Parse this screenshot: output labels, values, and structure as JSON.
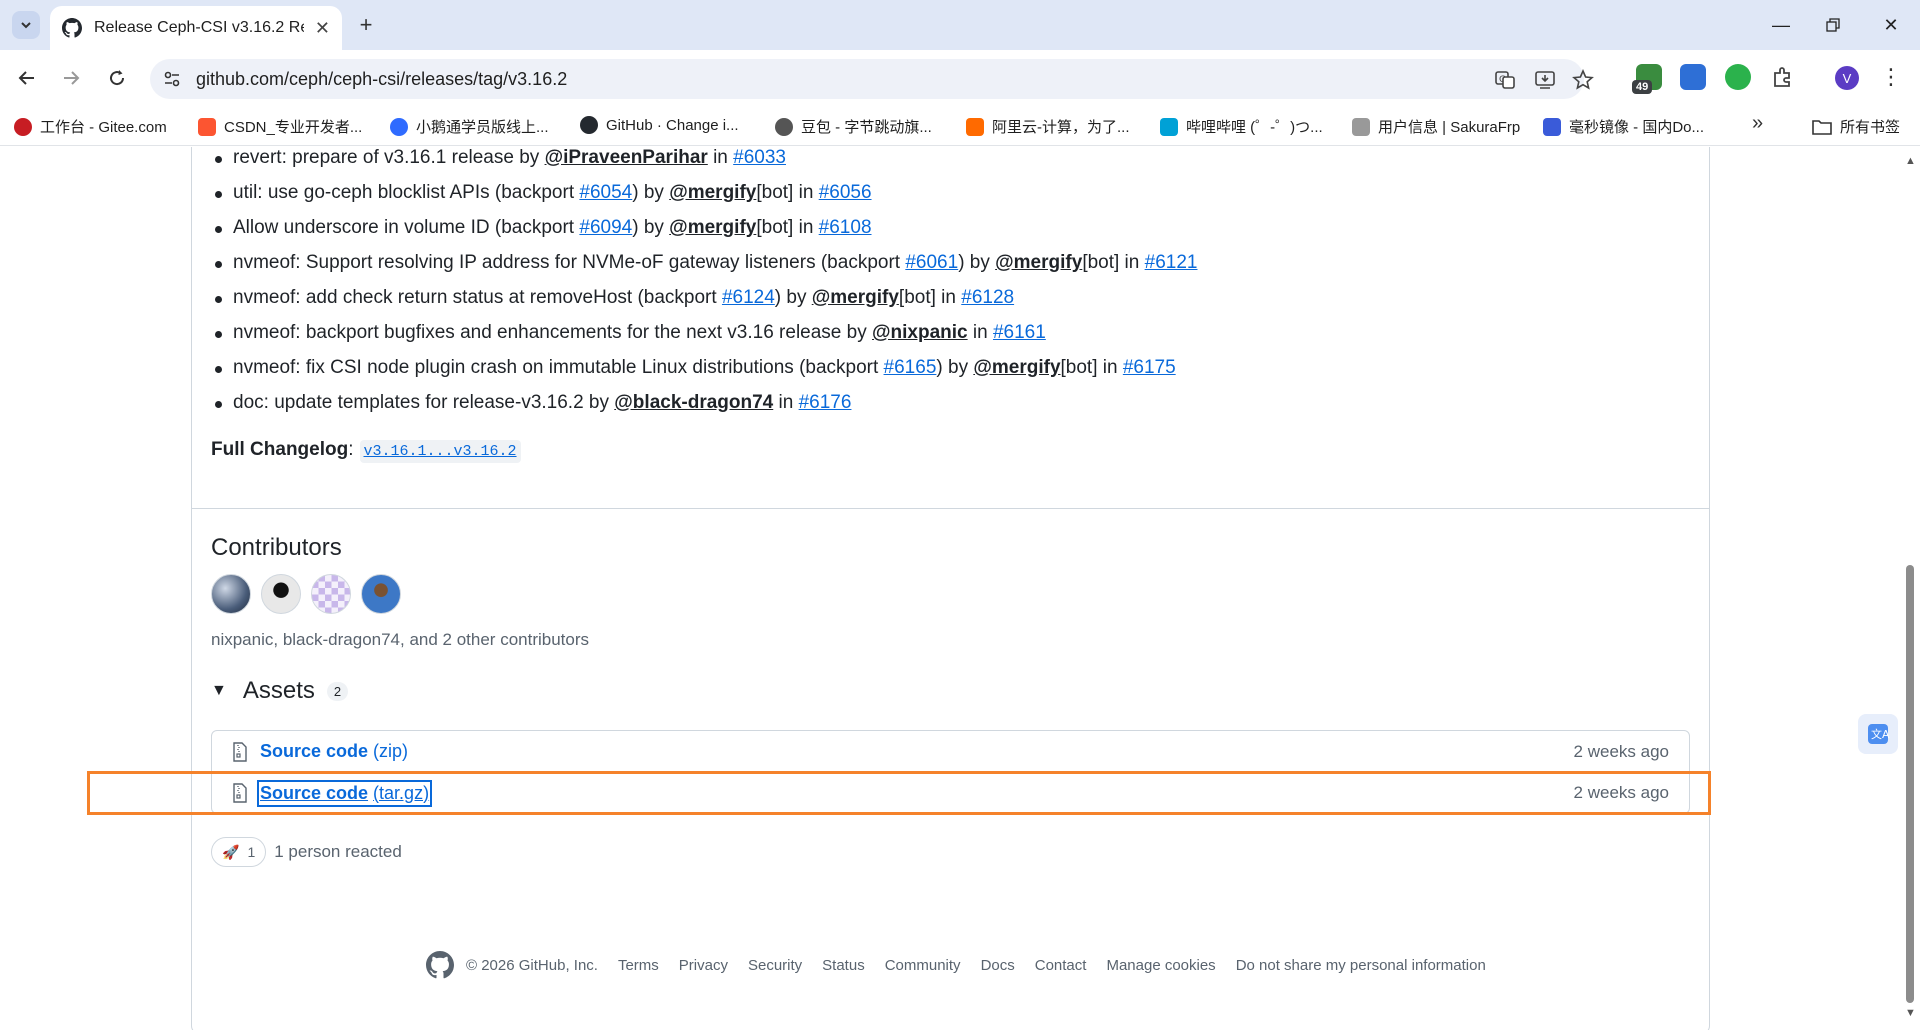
{
  "browser": {
    "tab_title": "Release Ceph-CSI v3.16.2 Rel",
    "url": "github.com/ceph/ceph-csi/releases/tag/v3.16.2",
    "extension_badge": "49",
    "profile_initial": "V"
  },
  "bookmarks": [
    {
      "label": "工作台 - Gitee.com",
      "color": "#c71d23"
    },
    {
      "label": "CSDN_专业开发者...",
      "color": "#fc5531"
    },
    {
      "label": "小鹅通学员版线上...",
      "color": "#2f6bff"
    },
    {
      "label": "GitHub · Change i...",
      "color": "#24292f"
    },
    {
      "label": "豆包 - 字节跳动旗...",
      "color": "#555555"
    },
    {
      "label": "阿里云-计算，为了...",
      "color": "#ff6a00"
    },
    {
      "label": "哔哩哔哩 (゜-゜)つ...",
      "color": "#00a1d6"
    },
    {
      "label": "用户信息 | SakuraFrp",
      "color": "#999999"
    },
    {
      "label": "毫秒镜像 - 国内Do...",
      "color": "#3a5bd9"
    }
  ],
  "bookmarks_folder": "所有书签",
  "changes": [
    {
      "pre": "revert: prepare of v3.16.1 release by ",
      "user": "@iPraveenParihar",
      "mid": " in ",
      "pr": "#6033"
    },
    {
      "pre": "util: use go-ceph blocklist APIs (backport ",
      "bp": "#6054",
      "bp_post": ") by ",
      "user": "@mergify",
      "post_user": "[bot] in ",
      "pr": "#6056"
    },
    {
      "pre": "Allow underscore in volume ID (backport ",
      "bp": "#6094",
      "bp_post": ") by ",
      "user": "@mergify",
      "post_user": "[bot] in ",
      "pr": "#6108"
    },
    {
      "pre": "nvmeof: Support resolving IP address for NVMe-oF gateway listeners (backport ",
      "bp": "#6061",
      "bp_post": ") by ",
      "user": "@mergify",
      "post_user": "[bot] in ",
      "pr": "#6121"
    },
    {
      "pre": "nvmeof: add check return status at removeHost (backport ",
      "bp": "#6124",
      "bp_post": ") by ",
      "user": "@mergify",
      "post_user": "[bot] in ",
      "pr": "#6128"
    },
    {
      "pre": "nvmeof: backport bugfixes and enhancements for the next v3.16 release by ",
      "user": "@nixpanic",
      "mid": " in ",
      "pr": "#6161"
    },
    {
      "pre": "nvmeof: fix CSI node plugin crash on immutable Linux distributions (backport ",
      "bp": "#6165",
      "bp_post": ") by ",
      "user": "@mergify",
      "post_user": "[bot] in ",
      "pr": "#6175"
    },
    {
      "pre": "doc: update templates for release-v3.16.2 by ",
      "user": "@black-dragon74",
      "mid": " in ",
      "pr": "#6176"
    }
  ],
  "changelog": {
    "label": "Full Changelog",
    "sep": ":",
    "range": "v3.16.1...v3.16.2"
  },
  "contributors": {
    "title": "Contributors",
    "summary": "nixpanic, black-dragon74, and 2 other contributors"
  },
  "assets": {
    "title": "Assets",
    "count": "2",
    "rows": [
      {
        "name": "Source code",
        "ext": "(zip)",
        "time": "2 weeks ago"
      },
      {
        "name": "Source code",
        "ext": "(tar.gz)",
        "time": "2 weeks ago"
      }
    ]
  },
  "reactions": {
    "count": "1",
    "text": "1 person reacted"
  },
  "footer": {
    "copyright": "© 2026 GitHub, Inc.",
    "links": [
      "Terms",
      "Privacy",
      "Security",
      "Status",
      "Community",
      "Docs",
      "Contact",
      "Manage cookies",
      "Do not share my personal information"
    ]
  },
  "colors": {
    "link": "#0969da",
    "highlight": "#f5822a",
    "tabstrip": "#dfe7f6"
  }
}
